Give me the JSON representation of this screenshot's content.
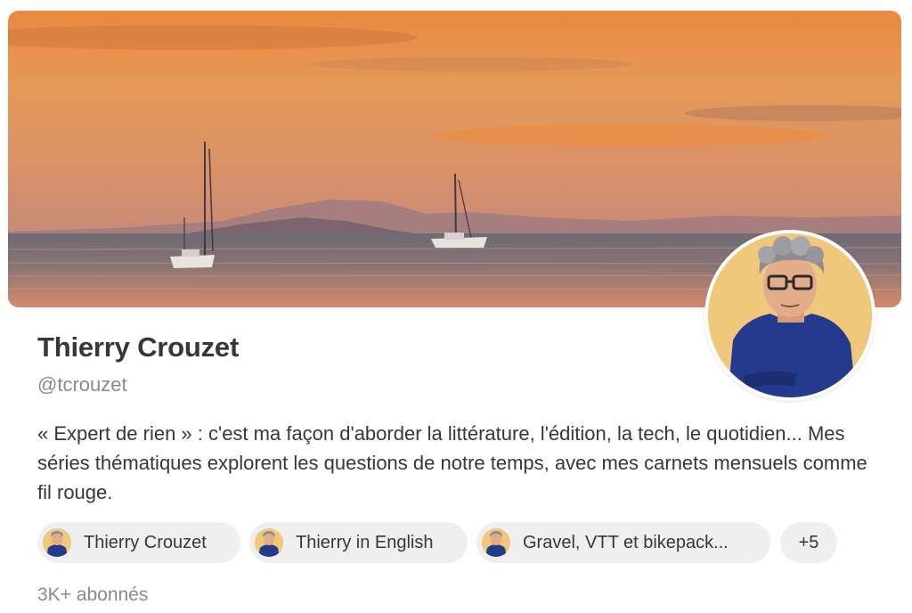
{
  "profile": {
    "name": "Thierry Crouzet",
    "handle": "@tcrouzet",
    "bio": "« Expert de rien » : c'est ma façon d'aborder la littérature, l'édition, la tech, le quotidien... Mes séries thématiques explorent les questions de notre temps, avec mes carnets mensuels comme fil rouge.",
    "subscribers": "3K+ abonnés"
  },
  "publications": [
    {
      "label": "Thierry Crouzet",
      "icon": "author-avatar-icon"
    },
    {
      "label": "Thierry in English",
      "icon": "author-avatar-icon"
    },
    {
      "label": "Gravel, VTT et bikepack...",
      "icon": "author-avatar-icon"
    }
  ],
  "more_publications": "+5",
  "banner": {
    "description_icon": "sunset-sea-sailboats-photo"
  },
  "colors": {
    "text": "#363737",
    "muted": "#8a8a8a",
    "pill": "#efefef"
  }
}
